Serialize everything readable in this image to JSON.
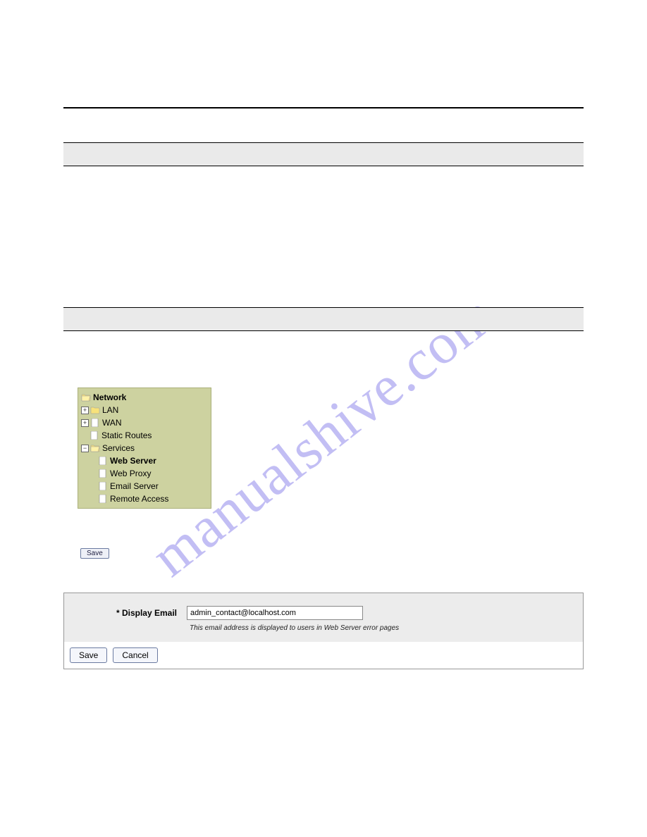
{
  "watermark": "manualshive.com",
  "tree": {
    "root": "Network",
    "lan": "LAN",
    "wan": "WAN",
    "static_routes": "Static Routes",
    "services": "Services",
    "web_server": "Web Server",
    "web_proxy": "Web Proxy",
    "email_server": "Email Server",
    "remote_access": "Remote Access"
  },
  "mini_save": "Save",
  "form": {
    "label": "* Display Email",
    "value": "admin_contact@localhost.com",
    "help": "This email address is displayed to users in Web Server error pages"
  },
  "buttons": {
    "save": "Save",
    "cancel": "Cancel"
  }
}
